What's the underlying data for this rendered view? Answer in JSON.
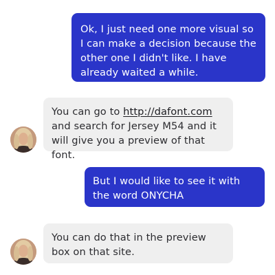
{
  "conversation": {
    "messages": [
      {
        "sender": "user",
        "text": "Ok, I just need one more visual so I can make a decision because the other one I didn't like. I have already waited a while."
      },
      {
        "sender": "contact",
        "text_before": "You can go to ",
        "link": "http://dafont.com",
        "text_after": " and search for Jersey M54 and it will give you a preview of that font."
      },
      {
        "sender": "user",
        "text": "But I would like to see it with the word ONYCHA"
      },
      {
        "sender": "contact",
        "text": "You can do that in the preview box on that site."
      }
    ]
  },
  "colors": {
    "outgoing_bubble": "#2a35c9",
    "incoming_bubble": "#efefef",
    "outgoing_text": "#ffffff",
    "incoming_text": "#2c2c30"
  }
}
